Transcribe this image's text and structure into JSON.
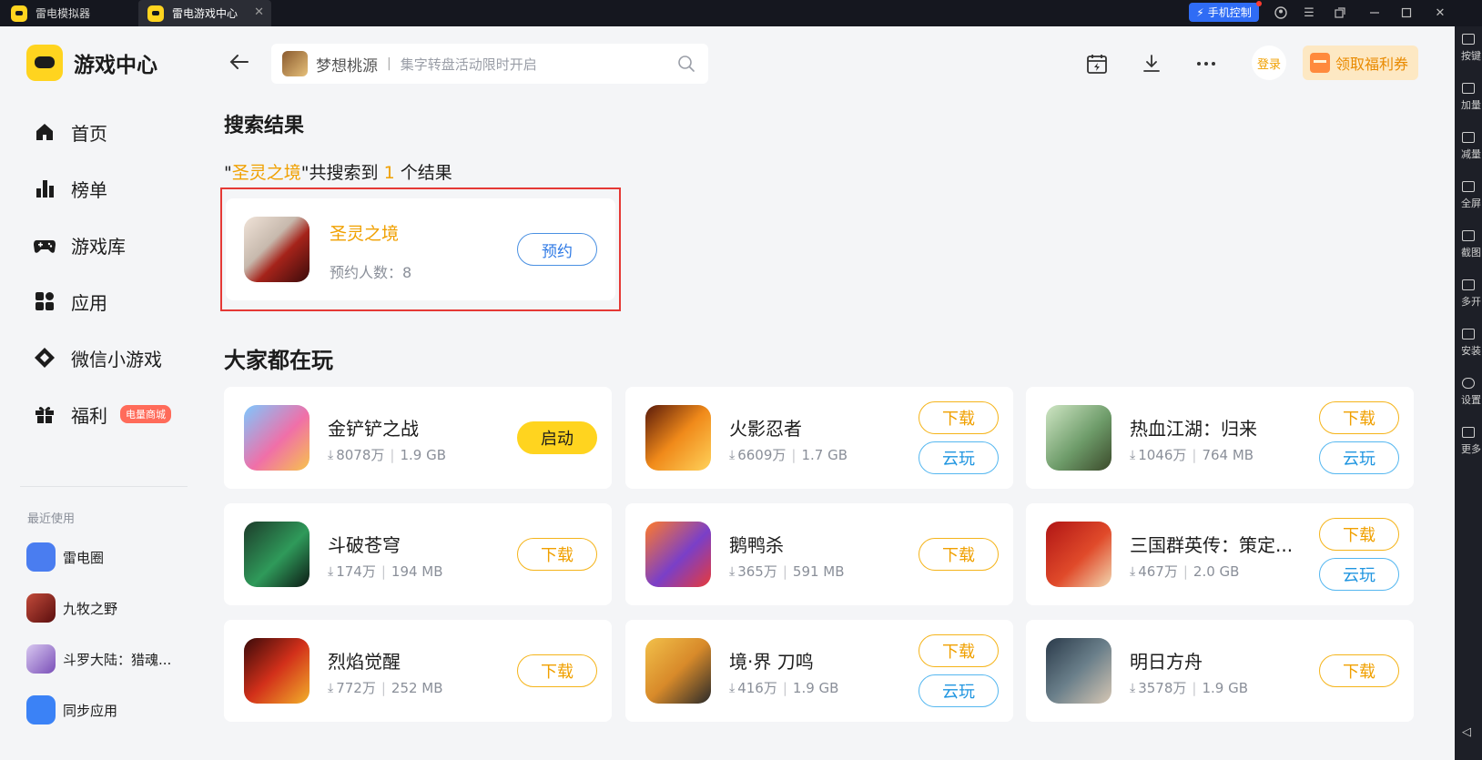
{
  "titlebar": {
    "tabs": [
      {
        "label": "雷电模拟器"
      },
      {
        "label": "雷电游戏中心"
      }
    ],
    "phone_control_label": "手机控制"
  },
  "right_toolbar": {
    "items": [
      {
        "label": "按键"
      },
      {
        "label": "加量"
      },
      {
        "label": "减量"
      },
      {
        "label": "全屏"
      },
      {
        "label": "截图"
      },
      {
        "label": "多开"
      },
      {
        "label": "安装"
      },
      {
        "label": "设置"
      },
      {
        "label": "更多"
      }
    ]
  },
  "sidebar": {
    "brand": "游戏中心",
    "nav": [
      {
        "label": "首页",
        "icon": "home-icon"
      },
      {
        "label": "榜单",
        "icon": "ranking-icon"
      },
      {
        "label": "游戏库",
        "icon": "gamepad-icon"
      },
      {
        "label": "应用",
        "icon": "apps-icon"
      },
      {
        "label": "微信小游戏",
        "icon": "diamond-icon"
      },
      {
        "label": "福利",
        "icon": "gift-icon",
        "badge": "电量商城"
      }
    ],
    "recent_title": "最近使用",
    "recent": [
      {
        "label": "雷电圈",
        "color": "#4a7df0"
      },
      {
        "label": "九牧之野",
        "color": "#8b1d1d"
      },
      {
        "label": "斗罗大陆：猎魂...",
        "color": "#7a4fb8"
      },
      {
        "label": "同步应用",
        "color": "#3b82f6"
      }
    ]
  },
  "header": {
    "search_game": "梦想桃源",
    "search_separator": "|",
    "search_placeholder": "集字转盘活动限时开启",
    "login_label": "登录",
    "coupon_label": "领取福利券"
  },
  "search_results": {
    "title": "搜索结果",
    "summary_prefix": "\"",
    "query": "圣灵之境",
    "summary_mid": "\"共搜索到",
    "count": "1",
    "summary_suffix": "个结果",
    "result": {
      "name": "圣灵之境",
      "meta": "预约人数：8",
      "button": "预约"
    }
  },
  "popular": {
    "title": "大家都在玩",
    "games": [
      {
        "name": "金铲铲之战",
        "downloads": "8078万",
        "size": "1.9 GB",
        "primary": "启动",
        "secondary": "",
        "color": "linear-gradient(135deg,#7dc8ff,#f06fa8 55%,#f7c34c)"
      },
      {
        "name": "火影忍者",
        "downloads": "6609万",
        "size": "1.7 GB",
        "primary": "下载",
        "secondary": "云玩",
        "color": "linear-gradient(135deg,#5a1a0a,#f08a1a 50%,#ffd25a)"
      },
      {
        "name": "热血江湖：归来",
        "downloads": "1046万",
        "size": "764 MB",
        "primary": "下载",
        "secondary": "云玩",
        "color": "linear-gradient(135deg,#cfe6c4,#6e9c6a 55%,#3b4a2a)"
      },
      {
        "name": "斗破苍穹",
        "downloads": "174万",
        "size": "194 MB",
        "primary": "下载",
        "secondary": "",
        "color": "linear-gradient(135deg,#1d3b2a,#2f9a5a 55%,#0c1a14)"
      },
      {
        "name": "鹅鸭杀",
        "downloads": "365万",
        "size": "591 MB",
        "primary": "下载",
        "secondary": "",
        "color": "linear-gradient(135deg,#ff7a2a,#7a3fc8 55%,#e83a3a)"
      },
      {
        "name": "三国群英传：策定...",
        "downloads": "467万",
        "size": "2.0 GB",
        "primary": "下载",
        "secondary": "云玩",
        "color": "linear-gradient(135deg,#b01515,#e04a2a 55%,#f2d7b0)"
      },
      {
        "name": "烈焰觉醒",
        "downloads": "772万",
        "size": "252 MB",
        "primary": "下载",
        "secondary": "",
        "color": "linear-gradient(135deg,#3a0a0a,#d2301a 50%,#f2b02a)"
      },
      {
        "name": "境·界 刀鸣",
        "downloads": "416万",
        "size": "1.9 GB",
        "primary": "下载",
        "secondary": "云玩",
        "color": "linear-gradient(135deg,#f2c04a,#d88a2a 50%,#2a2a2a)"
      },
      {
        "name": "明日方舟",
        "downloads": "3578万",
        "size": "1.9 GB",
        "primary": "下载",
        "secondary": "",
        "color": "linear-gradient(135deg,#2a3a4a,#6a7f8a 50%,#d6c7b4)"
      }
    ]
  }
}
